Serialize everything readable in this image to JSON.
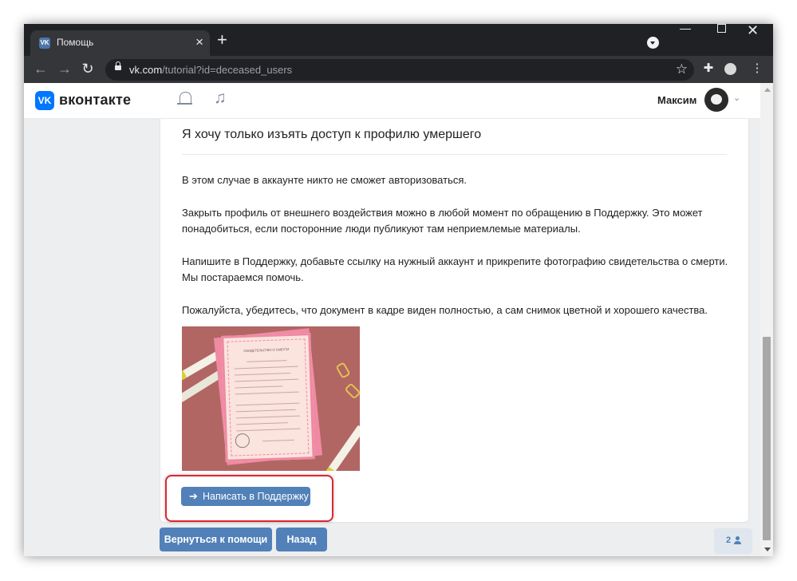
{
  "browser": {
    "tab_title": "Помощь",
    "favicon_text": "VK",
    "url_host": "vk.com",
    "url_path": "/tutorial?id=deceased_users"
  },
  "header": {
    "site_name": "вконтакте",
    "logo_text": "VK",
    "user_name": "Максим"
  },
  "article": {
    "heading": "Я хочу только изъять доступ к профилю умершего",
    "paragraphs": [
      "В этом случае в аккаунте никто не сможет авторизоваться.",
      "Закрыть профиль от внешнего воздействия можно в любой момент по обращению в Поддержку. Это может понадобиться, если посторонние люди публикуют там неприемлемые материалы.",
      "Напишите в Поддержку, добавьте ссылку на нужный аккаунт и прикрепите фотографию свидетельства о смерти. Мы постараемся помочь.",
      "Пожалуйста, убедитесь, что документ в кадре виден полностью, а сам снимок цветной и хорошего качества."
    ],
    "certificate_title": "СВИДЕТЕЛЬСТВО О СМЕРТИ",
    "support_button": "Написать в Поддержку"
  },
  "footer": {
    "back_to_help": "Вернуться к помощи",
    "back": "Назад",
    "counter": "2"
  },
  "icons": {
    "tab_close": "close-icon",
    "new_tab": "plus-icon",
    "back": "arrow-left-icon",
    "forward": "arrow-right-icon",
    "reload": "reload-icon",
    "bookmark": "star-icon",
    "extensions": "puzzle-icon",
    "menu": "kebab-menu-icon",
    "notifications": "bell-icon",
    "music": "music-note-icon"
  },
  "colors": {
    "vk_blue": "#0077ff",
    "button_blue": "#5181b8",
    "highlight_red": "#e0242f",
    "page_bg": "#edeef0"
  }
}
